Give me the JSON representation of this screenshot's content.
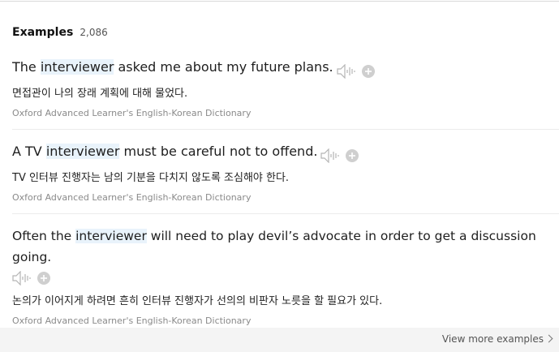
{
  "section": {
    "title": "Examples",
    "count": "2,086"
  },
  "examples": [
    {
      "pre": "The ",
      "highlight": "interviewer",
      "post": " asked me about my future plans.",
      "translation": "면접관이 나의 장래 계획에 대해 물었다.",
      "source": "Oxford Advanced Learner's English-Korean Dictionary"
    },
    {
      "pre": "A TV ",
      "highlight": "interviewer",
      "post": " must be careful not to offend.",
      "translation": "TV 인터뷰 진행자는 남의 기분을 다치지 않도록 조심해야 한다.",
      "source": "Oxford Advanced Learner's English-Korean Dictionary"
    },
    {
      "pre": "Often the ",
      "highlight": "interviewer",
      "post": " will need to play devil’s advocate in order to get a discussion going.",
      "translation": "논의가 이어지게 하려면 흔히 인터뷰 진행자가 선의의 비판자 노릇을 할 필요가 있다.",
      "source": "Oxford Advanced Learner's English-Korean Dictionary"
    }
  ],
  "footer": {
    "more_label": "View more examples"
  },
  "icons": {
    "speaker": "speaker-icon",
    "add": "add-icon",
    "more": "chevron-right-icon"
  },
  "colors": {
    "highlight_bg": "#e9f3fb",
    "icon_gray": "#b5b5b5",
    "source_text": "#8a8a8a"
  }
}
